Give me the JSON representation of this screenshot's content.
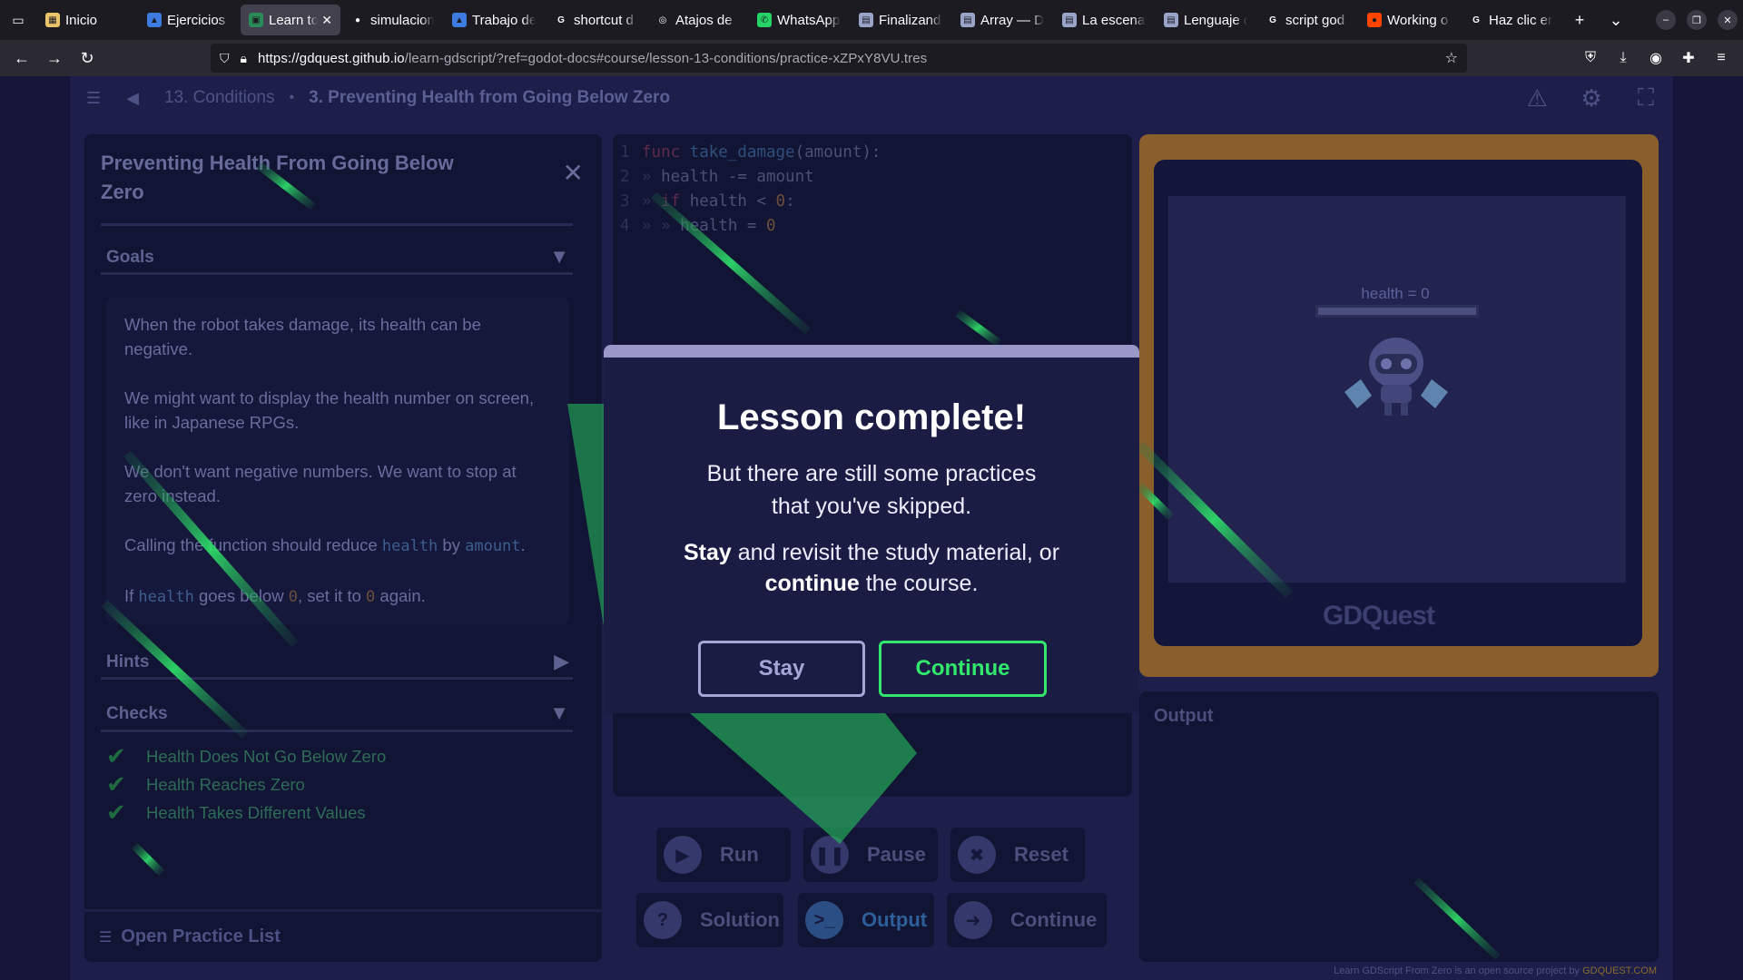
{
  "browser": {
    "tabs": [
      {
        "label": "Inicio",
        "color": "#e9c46a",
        "glyph": "▦"
      },
      {
        "label": "Ejercicios",
        "color": "#3d7be0",
        "glyph": "▲"
      },
      {
        "label": "Learn to",
        "color": "#2b8a5a",
        "glyph": "▣",
        "active": true
      },
      {
        "label": "simulacion",
        "color": "#ffffff",
        "glyph": "●"
      },
      {
        "label": "Trabajo de",
        "color": "#3d7be0",
        "glyph": "▲"
      },
      {
        "label": "shortcut d",
        "color": "#ffffff",
        "glyph": "G"
      },
      {
        "label": "Atajos de",
        "color": "#ffffff",
        "glyph": "◎"
      },
      {
        "label": "WhatsApp",
        "color": "#25d366",
        "glyph": "✆"
      },
      {
        "label": "Finalizand",
        "color": "#9aa4c8",
        "glyph": "▤"
      },
      {
        "label": "Array — D",
        "color": "#9aa4c8",
        "glyph": "▤"
      },
      {
        "label": "La escena",
        "color": "#9aa4c8",
        "glyph": "▤"
      },
      {
        "label": "Lenguaje d",
        "color": "#9aa4c8",
        "glyph": "▤"
      },
      {
        "label": "script god",
        "color": "#ffffff",
        "glyph": "G"
      },
      {
        "label": "Working o",
        "color": "#ff4500",
        "glyph": "●"
      },
      {
        "label": "Haz clic en",
        "color": "#ffffff",
        "glyph": "G"
      }
    ],
    "url_host": "https://gdquest.github.io",
    "url_rest": "/learn-gdscript/?ref=godot-docs#course/lesson-13-conditions/practice-xZPxY8VU.tres"
  },
  "topbar": {
    "lesson": "13. Conditions",
    "separator": "•",
    "practice": "3. Preventing Health from Going Below Zero"
  },
  "practice": {
    "title": "Preventing Health From Going Below Zero",
    "goals_label": "Goals",
    "goals": {
      "p1": "When the robot takes damage, its health can be negative.",
      "p2": "We might want to display the health number on screen, like in Japanese RPGs.",
      "p3": "We don't want negative numbers. We want to stop at zero instead.",
      "p4_a": "Calling the function should reduce ",
      "p4_code1": "health",
      "p4_b": " by ",
      "p4_code2": "amount",
      "p4_c": ".",
      "p5_a": "If ",
      "p5_code1": "health",
      "p5_b": " goes below ",
      "p5_code2": "0",
      "p5_c": ", set it to ",
      "p5_code3": "0",
      "p5_d": " again."
    },
    "hints_label": "Hints",
    "checks_label": "Checks",
    "checks": [
      "Health Does Not Go Below Zero",
      "Health Reaches Zero",
      "Health Takes Different Values"
    ],
    "open_practice_list": "Open Practice List"
  },
  "editor": {
    "lines": [
      {
        "num": "1",
        "kw": "func",
        "rest_fn": "take_damage",
        "rest": "(amount):"
      },
      {
        "num": "2",
        "indent": "» ",
        "text": "health -= amount"
      },
      {
        "num": "3",
        "indent": "» ",
        "kw": "if",
        "text": " health < ",
        "n": "0",
        "tail": ":"
      },
      {
        "num": "4",
        "indent": "» » ",
        "text": "health = ",
        "n": "0"
      }
    ]
  },
  "controls": {
    "run": "Run",
    "pause": "Pause",
    "reset": "Reset",
    "solution": "Solution",
    "output": "Output",
    "continue": "Continue"
  },
  "game": {
    "health_label": "health = 0",
    "logo": "GDQuest"
  },
  "output": {
    "title": "Output"
  },
  "footer": {
    "credit": "Learn GDScript From Zero is an open source project by ",
    "link": "GDQUEST.COM"
  },
  "modal": {
    "title": "Lesson complete!",
    "text1": "But there are still some practices that you've skipped.",
    "text2_b1": "Stay",
    "text2_a": " and revisit the study material, or ",
    "text2_b2": "continue",
    "text2_c": " the course.",
    "stay": "Stay",
    "continue": "Continue"
  },
  "colors": {
    "accent_green": "#31e86c",
    "modal_bar": "#9998c9",
    "game_frame": "#8a5f2c"
  }
}
